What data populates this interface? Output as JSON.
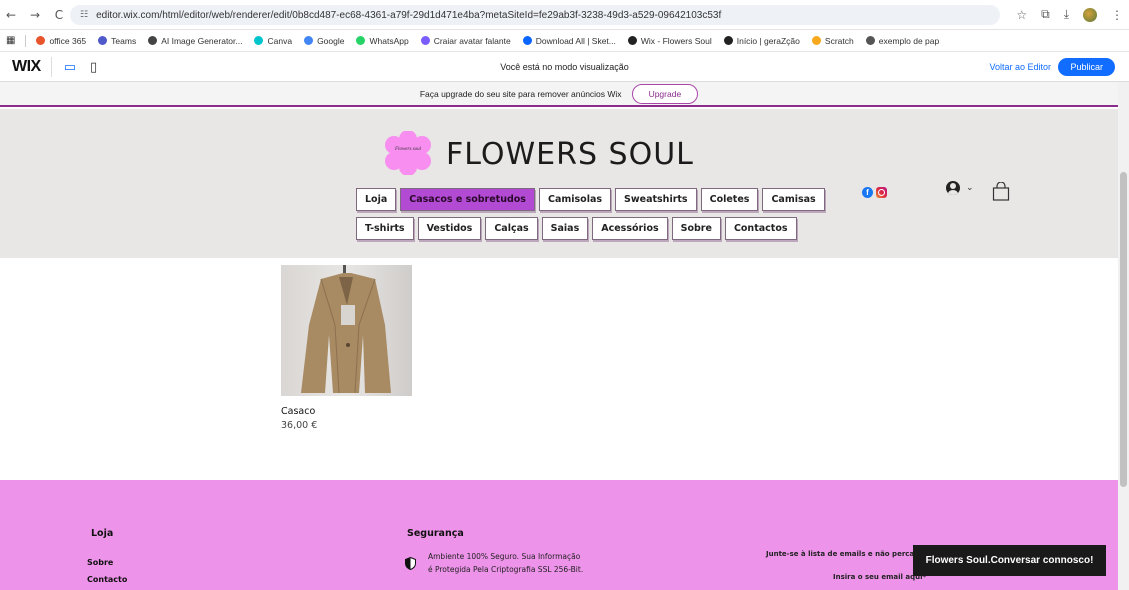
{
  "browser": {
    "url": "editor.wix.com/html/editor/web/renderer/edit/0b8cd487-ec68-4361-a79f-29d1d471e4ba?metaSiteId=fe29ab3f-3238-49d3-a529-09642103c53f",
    "back_icon": "←",
    "forward_icon": "→",
    "reload_icon": "C",
    "bookmarks": [
      {
        "label": "office 365",
        "color": "#e8542c"
      },
      {
        "label": "Teams",
        "color": "#5059c9"
      },
      {
        "label": "AI Image Generator...",
        "color": "#444444"
      },
      {
        "label": "Canva",
        "color": "#00c4cc"
      },
      {
        "label": "Google",
        "color": "#4285f4"
      },
      {
        "label": "WhatsApp",
        "color": "#25d366"
      },
      {
        "label": "Craiar avatar falante",
        "color": "#7b5cff"
      },
      {
        "label": "Download All | Sket...",
        "color": "#0a66ff"
      },
      {
        "label": "Wix - Flowers Soul",
        "color": "#222222"
      },
      {
        "label": "Início | geraZção",
        "color": "#222222"
      },
      {
        "label": "Scratch",
        "color": "#f7a81b"
      },
      {
        "label": "exemplo de pap",
        "color": "#555555"
      }
    ]
  },
  "wix_bar": {
    "logo": "WIX",
    "mode_text": "Você está no modo visualização",
    "back_to_editor": "Voltar ao Editor",
    "publish": "Publicar"
  },
  "upgrade": {
    "text": "Faça upgrade do seu site para remover anúncios Wix",
    "button": "Upgrade"
  },
  "site": {
    "logo_text": "Flowers soul",
    "brand": "FLOWERS SOUL",
    "menu_row1": [
      "Loja",
      "Casacos e sobretudos",
      "Camisolas",
      "Sweatshirts",
      "Coletes",
      "Camisas"
    ],
    "menu_row2": [
      "T-shirts",
      "Vestidos",
      "Calças",
      "Saias",
      "Acessórios",
      "Sobre",
      "Contactos"
    ],
    "active_menu": "Casacos e sobretudos"
  },
  "product": {
    "name": "Casaco",
    "price": "36,00 €"
  },
  "footer": {
    "col1_head": "Loja",
    "col1_links": [
      "Sobre",
      "Contacto"
    ],
    "col2_head": "Segurança",
    "col2_line1": "Ambiente 100% Seguro. Sua Informação",
    "col2_line2": "é Protegida Pela Criptografia SSL 256-Bit.",
    "newsletter": "Junte-se à lista de emails e não perca as",
    "email_placeholder": "Insira o seu email aqui*",
    "chat": "Flowers Soul.Conversar connosco!"
  },
  "colors": {
    "accent": "#b24ad4",
    "footer_bg": "#ee93ea",
    "wix_blue": "#116dff"
  }
}
